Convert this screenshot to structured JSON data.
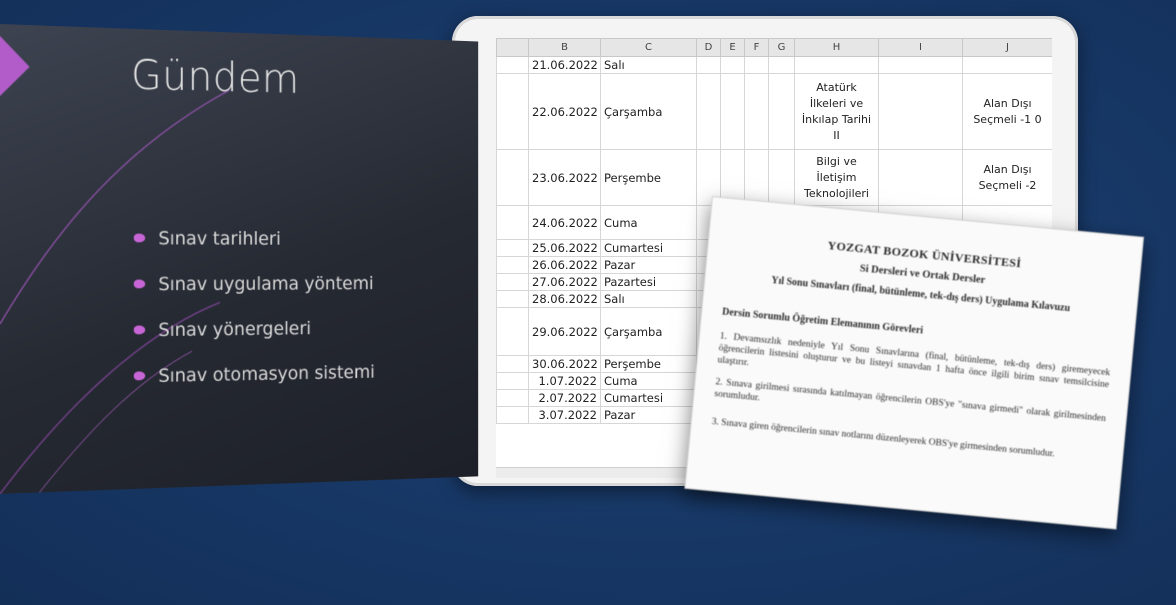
{
  "slide": {
    "title": "Gündem",
    "bullets": [
      "Sınav tarihleri",
      "Sınav uygulama yöntemi",
      "Sınav yönergeleri",
      "Sınav otomasyon sistemi"
    ],
    "accent_color": "#c765d6"
  },
  "spreadsheet": {
    "columns": [
      "B",
      "C",
      "D",
      "E",
      "F",
      "G",
      "H",
      "I",
      "J"
    ],
    "rows": [
      {
        "b": "21.06.2022",
        "c": "Salı",
        "h": "",
        "j": ""
      },
      {
        "b": "22.06.2022",
        "c": "Çarşamba",
        "h": "Atatürk İlkeleri ve İnkılap Tarihi II",
        "j": "Alan Dışı Seçmeli -1 0"
      },
      {
        "b": "23.06.2022",
        "c": "Perşembe",
        "h": "Bilgi ve İletişim Teknolojileri",
        "j": "Alan Dışı Seçmeli -2"
      },
      {
        "b": "24.06.2022",
        "c": "Cuma",
        "h": "",
        "j": ""
      },
      {
        "b": "25.06.2022",
        "c": "Cumartesi",
        "h": "",
        "j": ""
      },
      {
        "b": "26.06.2022",
        "c": "Pazar",
        "h": "",
        "j": ""
      },
      {
        "b": "27.06.2022",
        "c": "Pazartesi",
        "h": "",
        "j": ""
      },
      {
        "b": "28.06.2022",
        "c": "Salı",
        "h": "",
        "j": ""
      },
      {
        "b": "29.06.2022",
        "c": "Çarşamba",
        "h": "",
        "j": ""
      },
      {
        "b": "30.06.2022",
        "c": "Perşembe",
        "h": "",
        "j": ""
      },
      {
        "b": "1.07.2022",
        "c": "Cuma",
        "h": "",
        "j": ""
      },
      {
        "b": "2.07.2022",
        "c": "Cumartesi",
        "h": "",
        "j": ""
      },
      {
        "b": "3.07.2022",
        "c": "Pazar",
        "h": "",
        "j": ""
      }
    ]
  },
  "document": {
    "title": "YOZGAT BOZOK ÜNİVERSİTESİ",
    "subtitle": "Si Dersleri ve Ortak Dersler",
    "heading": "Yıl Sonu Sınavları (final, bütünleme, tek-dış ders) Uygulama Kılavuzu",
    "section": "Dersin Sorumlu Öğretim Elemanının Görevleri",
    "paragraphs": [
      "1. Devamsızlık nedeniyle Yıl Sonu Sınavlarına (final, bütünleme, tek-dış ders) giremeyecek öğrencilerin listesini oluşturur ve bu listeyi sınavdan 1 hafta önce ilgili birim sınav temsilcisine ulaştırır.",
      "2. Sınava girilmesi sırasında katılmayan öğrencilerin OBS'ye \"sınava girmedi\" olarak girilmesinden sorumludur.",
      "3. Sınava giren öğrencilerin sınav notlarını düzenleyerek OBS'ye girmesinden sorumludur."
    ]
  },
  "colors": {
    "background": "#173765",
    "slide": "#262a33",
    "accent": "#c765d6"
  }
}
